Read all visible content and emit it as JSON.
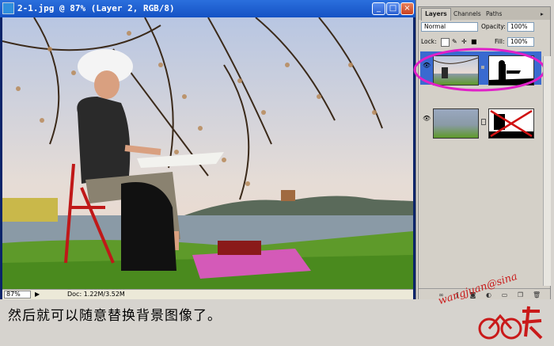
{
  "window": {
    "title": "2-1.jpg @ 87% (Layer 2, RGB/8)",
    "buttons": {
      "minimize": "_",
      "maximize": "□",
      "close": "×"
    }
  },
  "status_bar": {
    "zoom": "87%",
    "doc": "Doc: 1.22M/3.52M"
  },
  "layers_panel": {
    "tabs": [
      "Layers",
      "Channels",
      "Paths"
    ],
    "blend_mode": "Normal",
    "opacity_label": "Opacity:",
    "opacity_value": "100%",
    "lock_label": "Lock:",
    "fill_label": "Fill:",
    "fill_value": "100%"
  },
  "caption": "然后就可以随意替换背景图像了。",
  "watermark": "wangjuan@sina",
  "colors": {
    "highlight_ellipse": "#e020c8",
    "selected_layer": "#3a6ad0",
    "title_bar": "#1452c4"
  }
}
